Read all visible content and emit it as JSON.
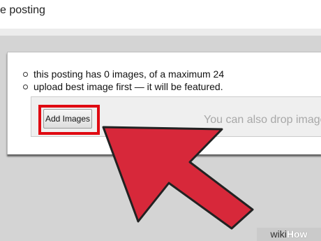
{
  "header": {
    "title": "e posting"
  },
  "posting": {
    "info_items": [
      "this posting has 0 images, of a maximum 24",
      "upload best image first — it will be featured."
    ],
    "add_images_label": "Add Images",
    "drop_hint": "You can also drop image"
  },
  "overlay": {
    "arrow_color": "#d7283a",
    "highlight_color": "#e00a12"
  },
  "watermark": {
    "prefix": "wiki",
    "brand": "How"
  }
}
